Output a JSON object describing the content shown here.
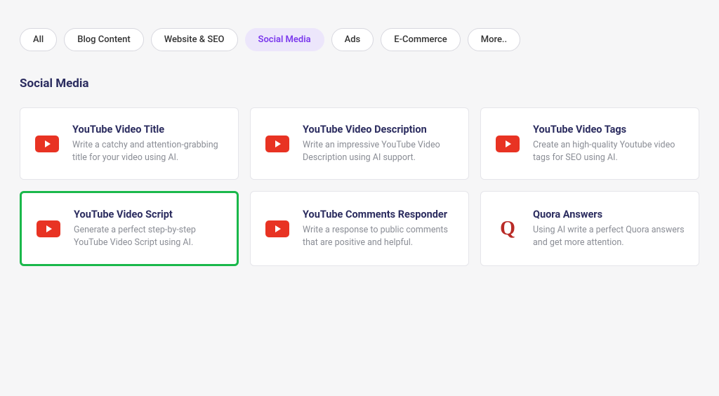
{
  "tabs": [
    {
      "label": "All",
      "active": false
    },
    {
      "label": "Blog Content",
      "active": false
    },
    {
      "label": "Website & SEO",
      "active": false
    },
    {
      "label": "Social Media",
      "active": true
    },
    {
      "label": "Ads",
      "active": false
    },
    {
      "label": "E-Commerce",
      "active": false
    },
    {
      "label": "More..",
      "active": false
    }
  ],
  "section_title": "Social Media",
  "cards": [
    {
      "title": "YouTube Video Title",
      "desc": "Write a catchy and attention-grabbing title for your video using AI.",
      "icon": "youtube",
      "highlighted": false
    },
    {
      "title": "YouTube Video Description",
      "desc": "Write an impressive YouTube Video Description using AI support.",
      "icon": "youtube",
      "highlighted": false
    },
    {
      "title": "YouTube Video Tags",
      "desc": "Create an high-quality Youtube video tags for SEO using AI.",
      "icon": "youtube",
      "highlighted": false
    },
    {
      "title": "YouTube Video Script",
      "desc": "Generate a perfect step-by-step YouTube Video Script using AI.",
      "icon": "youtube",
      "highlighted": true
    },
    {
      "title": "YouTube Comments Responder",
      "desc": "Write a response to public comments that are positive and helpful.",
      "icon": "youtube",
      "highlighted": false
    },
    {
      "title": "Quora Answers",
      "desc": "Using AI write a perfect Quora answers and get more attention.",
      "icon": "quora",
      "highlighted": false
    }
  ],
  "icons": {
    "quora_letter": "Q"
  }
}
